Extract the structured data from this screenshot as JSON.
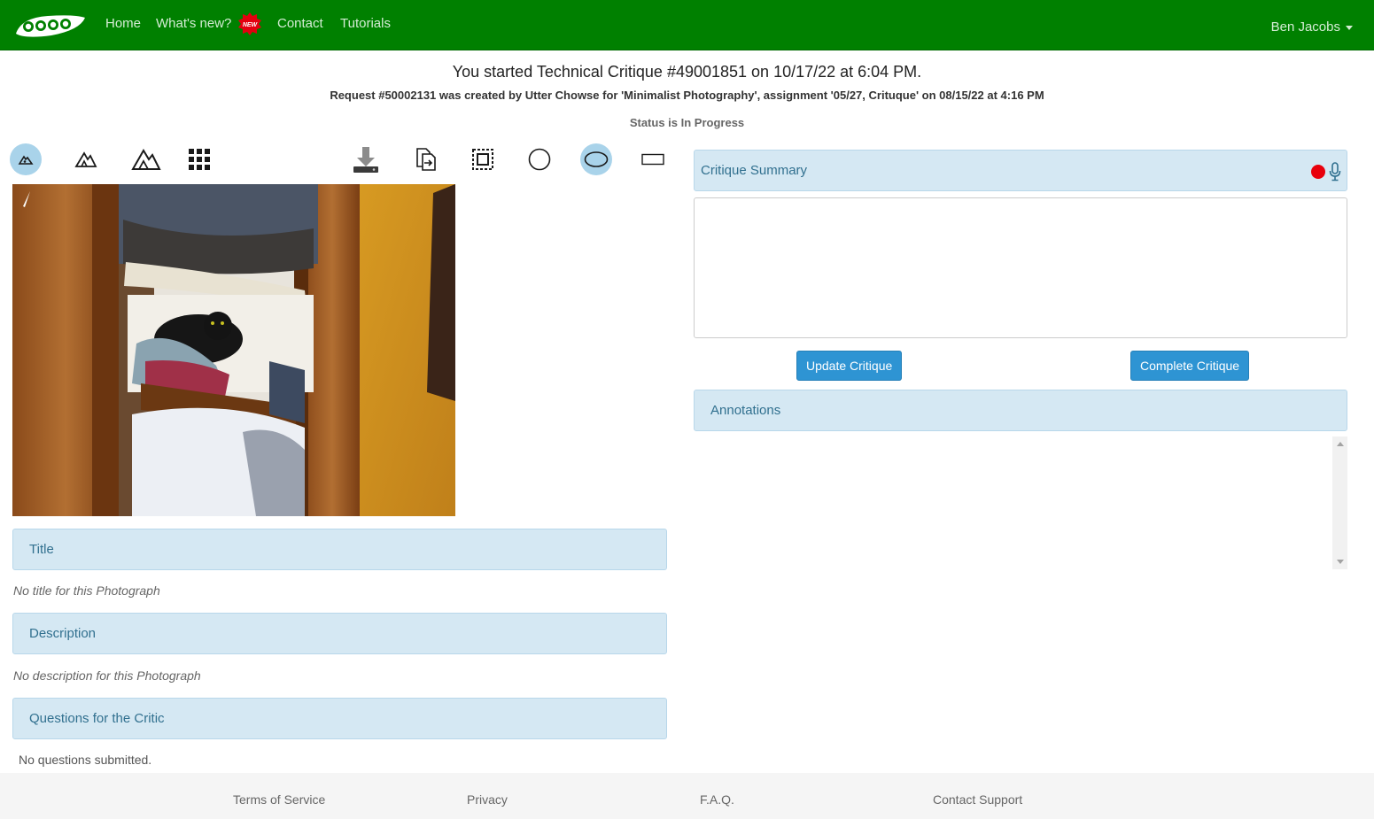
{
  "nav": {
    "home": "Home",
    "whats_new": "What's new?",
    "new_badge": "NEW",
    "contact": "Contact",
    "tutorials": "Tutorials",
    "user": "Ben Jacobs",
    "brand_color": "#008000"
  },
  "header": {
    "title": "You started Technical Critique #49001851 on 10/17/22 at 6:04 PM.",
    "request": "Request #50002131 was created by Utter Chowse for 'Minimalist Photography', assignment '05/27, Crituque' on 08/15/22 at 4:16 PM",
    "status": "Status is In Progress"
  },
  "toolbar": {
    "tools": [
      {
        "icon": "small-mountain-icon",
        "active": true
      },
      {
        "icon": "medium-mountain-icon",
        "active": false
      },
      {
        "icon": "large-mountain-icon",
        "active": false
      },
      {
        "icon": "grid-icon",
        "active": false
      },
      {
        "icon": "download-icon",
        "active": false
      },
      {
        "icon": "export-icon",
        "active": false
      },
      {
        "icon": "crop-select-icon",
        "active": false
      },
      {
        "icon": "circle-tool-icon",
        "active": false
      },
      {
        "icon": "ellipse-tool-icon",
        "active": true
      },
      {
        "icon": "rectangle-tool-icon",
        "active": false
      }
    ]
  },
  "photo": {
    "overlay_icon": "feather-icon"
  },
  "left_panels": {
    "title_label": "Title",
    "title_value": "No title for this Photograph",
    "description_label": "Description",
    "description_value": "No description for this Photograph",
    "questions_label": "Questions for the Critic",
    "questions_value": "No questions submitted."
  },
  "critique": {
    "summary_label": "Critique Summary",
    "summary_value": "",
    "record_icon": "record-icon",
    "mic_icon": "microphone-icon",
    "update_button": "Update Critique",
    "complete_button": "Complete Critique",
    "annotations_label": "Annotations",
    "button_color": "#2e94d3",
    "panel_color": "#d5e8f3"
  },
  "footer": {
    "terms": "Terms of Service",
    "privacy": "Privacy",
    "faq": "F.A.Q.",
    "support": "Contact Support"
  }
}
